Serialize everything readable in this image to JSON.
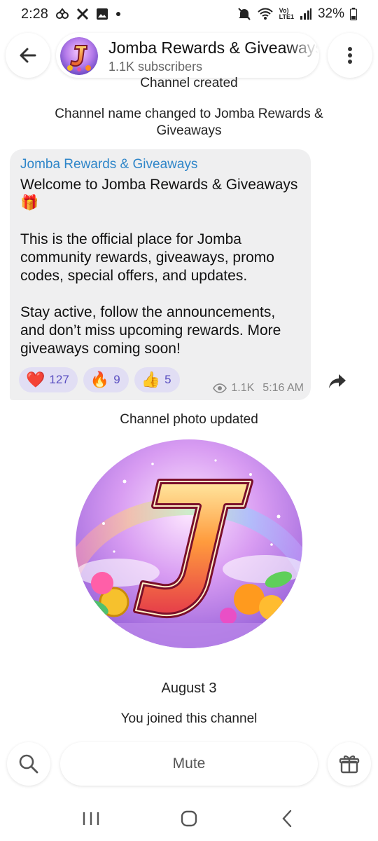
{
  "status_bar": {
    "time": "2:28",
    "battery": "32%",
    "icons": [
      "link-icon",
      "x-logo-icon",
      "gallery-icon",
      "dot-icon",
      "mute-icon",
      "wifi-icon",
      "volte-icon",
      "signal-icon",
      "battery-icon"
    ]
  },
  "header": {
    "title": "Jomba Rewards & Giveaways",
    "subtitle": "1.1K subscribers"
  },
  "system_messages": {
    "created": "Channel created",
    "renamed": "Channel name changed to Jomba Rewards & Giveaways",
    "photo_updated": "Channel photo updated",
    "date": "August 3",
    "joined": "You joined this channel"
  },
  "post": {
    "author": "Jomba Rewards & Giveaways",
    "text": "Welcome to Jomba Rewards & Giveaways 🎁\n\nThis is the official place for Jomba community rewards, giveaways, promo codes, special offers, and updates.\n\nStay active, follow the announcements, and don’t miss upcoming rewards. More giveaways coming soon!",
    "reactions": [
      {
        "emoji": "❤️",
        "count": "127"
      },
      {
        "emoji": "🔥",
        "count": "9"
      },
      {
        "emoji": "👍",
        "count": "5"
      }
    ],
    "views": "1.1K",
    "time": "5:16 AM"
  },
  "bottom_bar": {
    "mute_label": "Mute"
  },
  "colors": {
    "link_blue": "#2f86c9",
    "reaction_bg": "#e1def4",
    "reaction_text": "#5a4fc1",
    "bubble_bg": "#efeff0"
  }
}
